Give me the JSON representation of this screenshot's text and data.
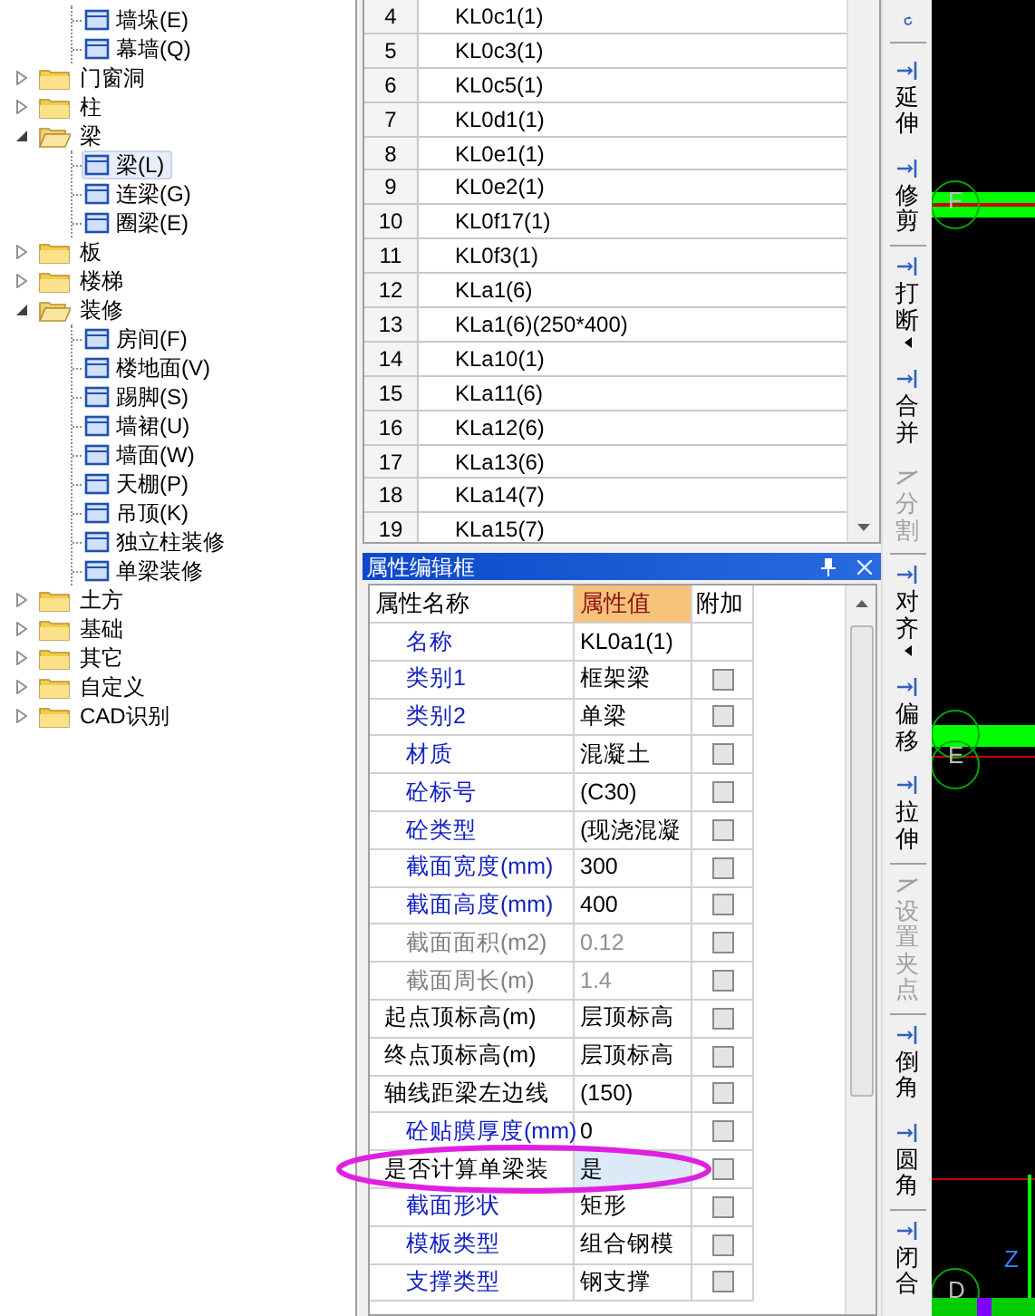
{
  "tree": [
    {
      "children": [
        {
          "label": "墙垛(E)",
          "selected": false
        },
        {
          "label": "幕墙(Q)",
          "selected": false
        }
      ]
    },
    {
      "label": "门窗洞",
      "expanded": false
    },
    {
      "label": "柱",
      "expanded": false
    },
    {
      "label": "梁",
      "expanded": true,
      "children": [
        {
          "label": "梁(L)",
          "selected": true
        },
        {
          "label": "连梁(G)",
          "selected": false
        },
        {
          "label": "圈梁(E)",
          "selected": false
        }
      ]
    },
    {
      "label": "板",
      "expanded": false
    },
    {
      "label": "楼梯",
      "expanded": false
    },
    {
      "label": "装修",
      "expanded": true,
      "children": [
        {
          "label": "房间(F)",
          "selected": false
        },
        {
          "label": "楼地面(V)",
          "selected": false
        },
        {
          "label": "踢脚(S)",
          "selected": false
        },
        {
          "label": "墙裙(U)",
          "selected": false
        },
        {
          "label": "墙面(W)",
          "selected": false
        },
        {
          "label": "天棚(P)",
          "selected": false
        },
        {
          "label": "吊顶(K)",
          "selected": false
        },
        {
          "label": "独立柱装修",
          "selected": false
        },
        {
          "label": "单梁装修",
          "selected": false
        }
      ]
    },
    {
      "label": "土方",
      "expanded": false
    },
    {
      "label": "基础",
      "expanded": false
    },
    {
      "label": "其它",
      "expanded": false
    },
    {
      "label": "自定义",
      "expanded": false
    },
    {
      "label": "CAD识别",
      "expanded": false
    }
  ],
  "component_list": {
    "rows": [
      {
        "number": "4",
        "name": "KL0c1(1)"
      },
      {
        "number": "5",
        "name": "KL0c3(1)"
      },
      {
        "number": "6",
        "name": "KL0c5(1)"
      },
      {
        "number": "7",
        "name": "KL0d1(1)"
      },
      {
        "number": "8",
        "name": "KL0e1(1)"
      },
      {
        "number": "9",
        "name": "KL0e2(1)"
      },
      {
        "number": "10",
        "name": "KL0f17(1)"
      },
      {
        "number": "11",
        "name": "KL0f3(1)"
      },
      {
        "number": "12",
        "name": "KLa1(6)"
      },
      {
        "number": "13",
        "name": "KLa1(6)(250*400)"
      },
      {
        "number": "14",
        "name": "KLa10(1)"
      },
      {
        "number": "15",
        "name": "KLa11(6)"
      },
      {
        "number": "16",
        "name": "KLa12(6)"
      },
      {
        "number": "17",
        "name": "KLa13(6)"
      },
      {
        "number": "18",
        "name": "KLa14(7)"
      },
      {
        "number": "19",
        "name": "KLa15(7)"
      }
    ]
  },
  "property_panel": {
    "title": "属性编辑框",
    "columns": [
      "属性名称",
      "属性值",
      "附加"
    ],
    "rows": [
      {
        "kind": "public",
        "name": "名称",
        "value": "KL0a1(1)",
        "selected": false
      },
      {
        "kind": "public",
        "name": "类别1",
        "value": "框架梁",
        "checked": false,
        "selected": false
      },
      {
        "kind": "public",
        "name": "类别2",
        "value": "单梁",
        "checked": false,
        "selected": false
      },
      {
        "kind": "public",
        "name": "材质",
        "value": "混凝土",
        "checked": false,
        "selected": false
      },
      {
        "kind": "public",
        "name": "砼标号",
        "value": "(C30)",
        "checked": false,
        "selected": false
      },
      {
        "kind": "public",
        "name": "砼类型",
        "value": "(现浇混凝",
        "checked": false,
        "selected": false
      },
      {
        "kind": "public",
        "name": "截面宽度(mm)",
        "value": "300",
        "checked": false,
        "selected": false
      },
      {
        "kind": "public",
        "name": "截面高度(mm)",
        "value": "400",
        "checked": false,
        "selected": false
      },
      {
        "kind": "computed",
        "name": "截面面积(m2)",
        "value": "0.12",
        "checked": false,
        "selected": false
      },
      {
        "kind": "computed",
        "name": "截面周长(m)",
        "value": "1.4",
        "checked": false,
        "selected": false
      },
      {
        "kind": "private",
        "name": "起点顶标高(m)",
        "value": "层顶标高",
        "checked": false,
        "selected": false
      },
      {
        "kind": "private",
        "name": "终点顶标高(m)",
        "value": "层顶标高",
        "checked": false,
        "selected": false
      },
      {
        "kind": "private",
        "name": "轴线距梁左边线",
        "value": "(150)",
        "checked": false,
        "selected": false
      },
      {
        "kind": "public",
        "name": "砼贴膜厚度(mm)",
        "value": "0",
        "checked": false,
        "selected": false
      },
      {
        "kind": "private",
        "name": "是否计算单梁装",
        "value": "是",
        "checked": false,
        "selected": true
      },
      {
        "kind": "public",
        "name": "截面形状",
        "value": "矩形",
        "checked": false,
        "selected": false
      },
      {
        "kind": "public",
        "name": "模板类型",
        "value": "组合钢模",
        "checked": false,
        "selected": false
      },
      {
        "kind": "public",
        "name": "支撑类型",
        "value": "钢支撑",
        "checked": false,
        "selected": false
      }
    ]
  },
  "toolbar": [
    {
      "kind": "icon"
    },
    {
      "kind": "icon"
    },
    {
      "kind": "tool",
      "label": "延伸",
      "disabled": false,
      "dropdown": false,
      "separator_after": false
    },
    {
      "kind": "tool",
      "label": "修剪",
      "disabled": false,
      "dropdown": false,
      "separator_after": true
    },
    {
      "kind": "tool",
      "label": "打断",
      "disabled": false,
      "dropdown": true,
      "separator_after": false
    },
    {
      "kind": "tool",
      "label": "合并",
      "disabled": false,
      "dropdown": false,
      "separator_after": false
    },
    {
      "kind": "tool",
      "label": "分割",
      "disabled": true,
      "dropdown": false,
      "separator_after": true
    },
    {
      "kind": "tool",
      "label": "对齐",
      "disabled": false,
      "dropdown": true,
      "separator_after": false
    },
    {
      "kind": "tool",
      "label": "偏移",
      "disabled": false,
      "dropdown": false,
      "separator_after": false
    },
    {
      "kind": "tool",
      "label": "拉伸",
      "disabled": false,
      "dropdown": false,
      "separator_after": true
    },
    {
      "kind": "tool",
      "label": "设置夹点",
      "disabled": true,
      "dropdown": false,
      "separator_after": true
    },
    {
      "kind": "tool",
      "label": "倒角",
      "disabled": false,
      "dropdown": false,
      "separator_after": false
    },
    {
      "kind": "tool",
      "label": "圆角",
      "disabled": false,
      "dropdown": false,
      "separator_after": true
    },
    {
      "kind": "tool",
      "label": "闭合",
      "disabled": false,
      "dropdown": false,
      "separator_after": false
    }
  ],
  "canvas": {
    "axis_labels": [
      "F",
      "E",
      "D"
    ],
    "ucs_label": "Z"
  }
}
